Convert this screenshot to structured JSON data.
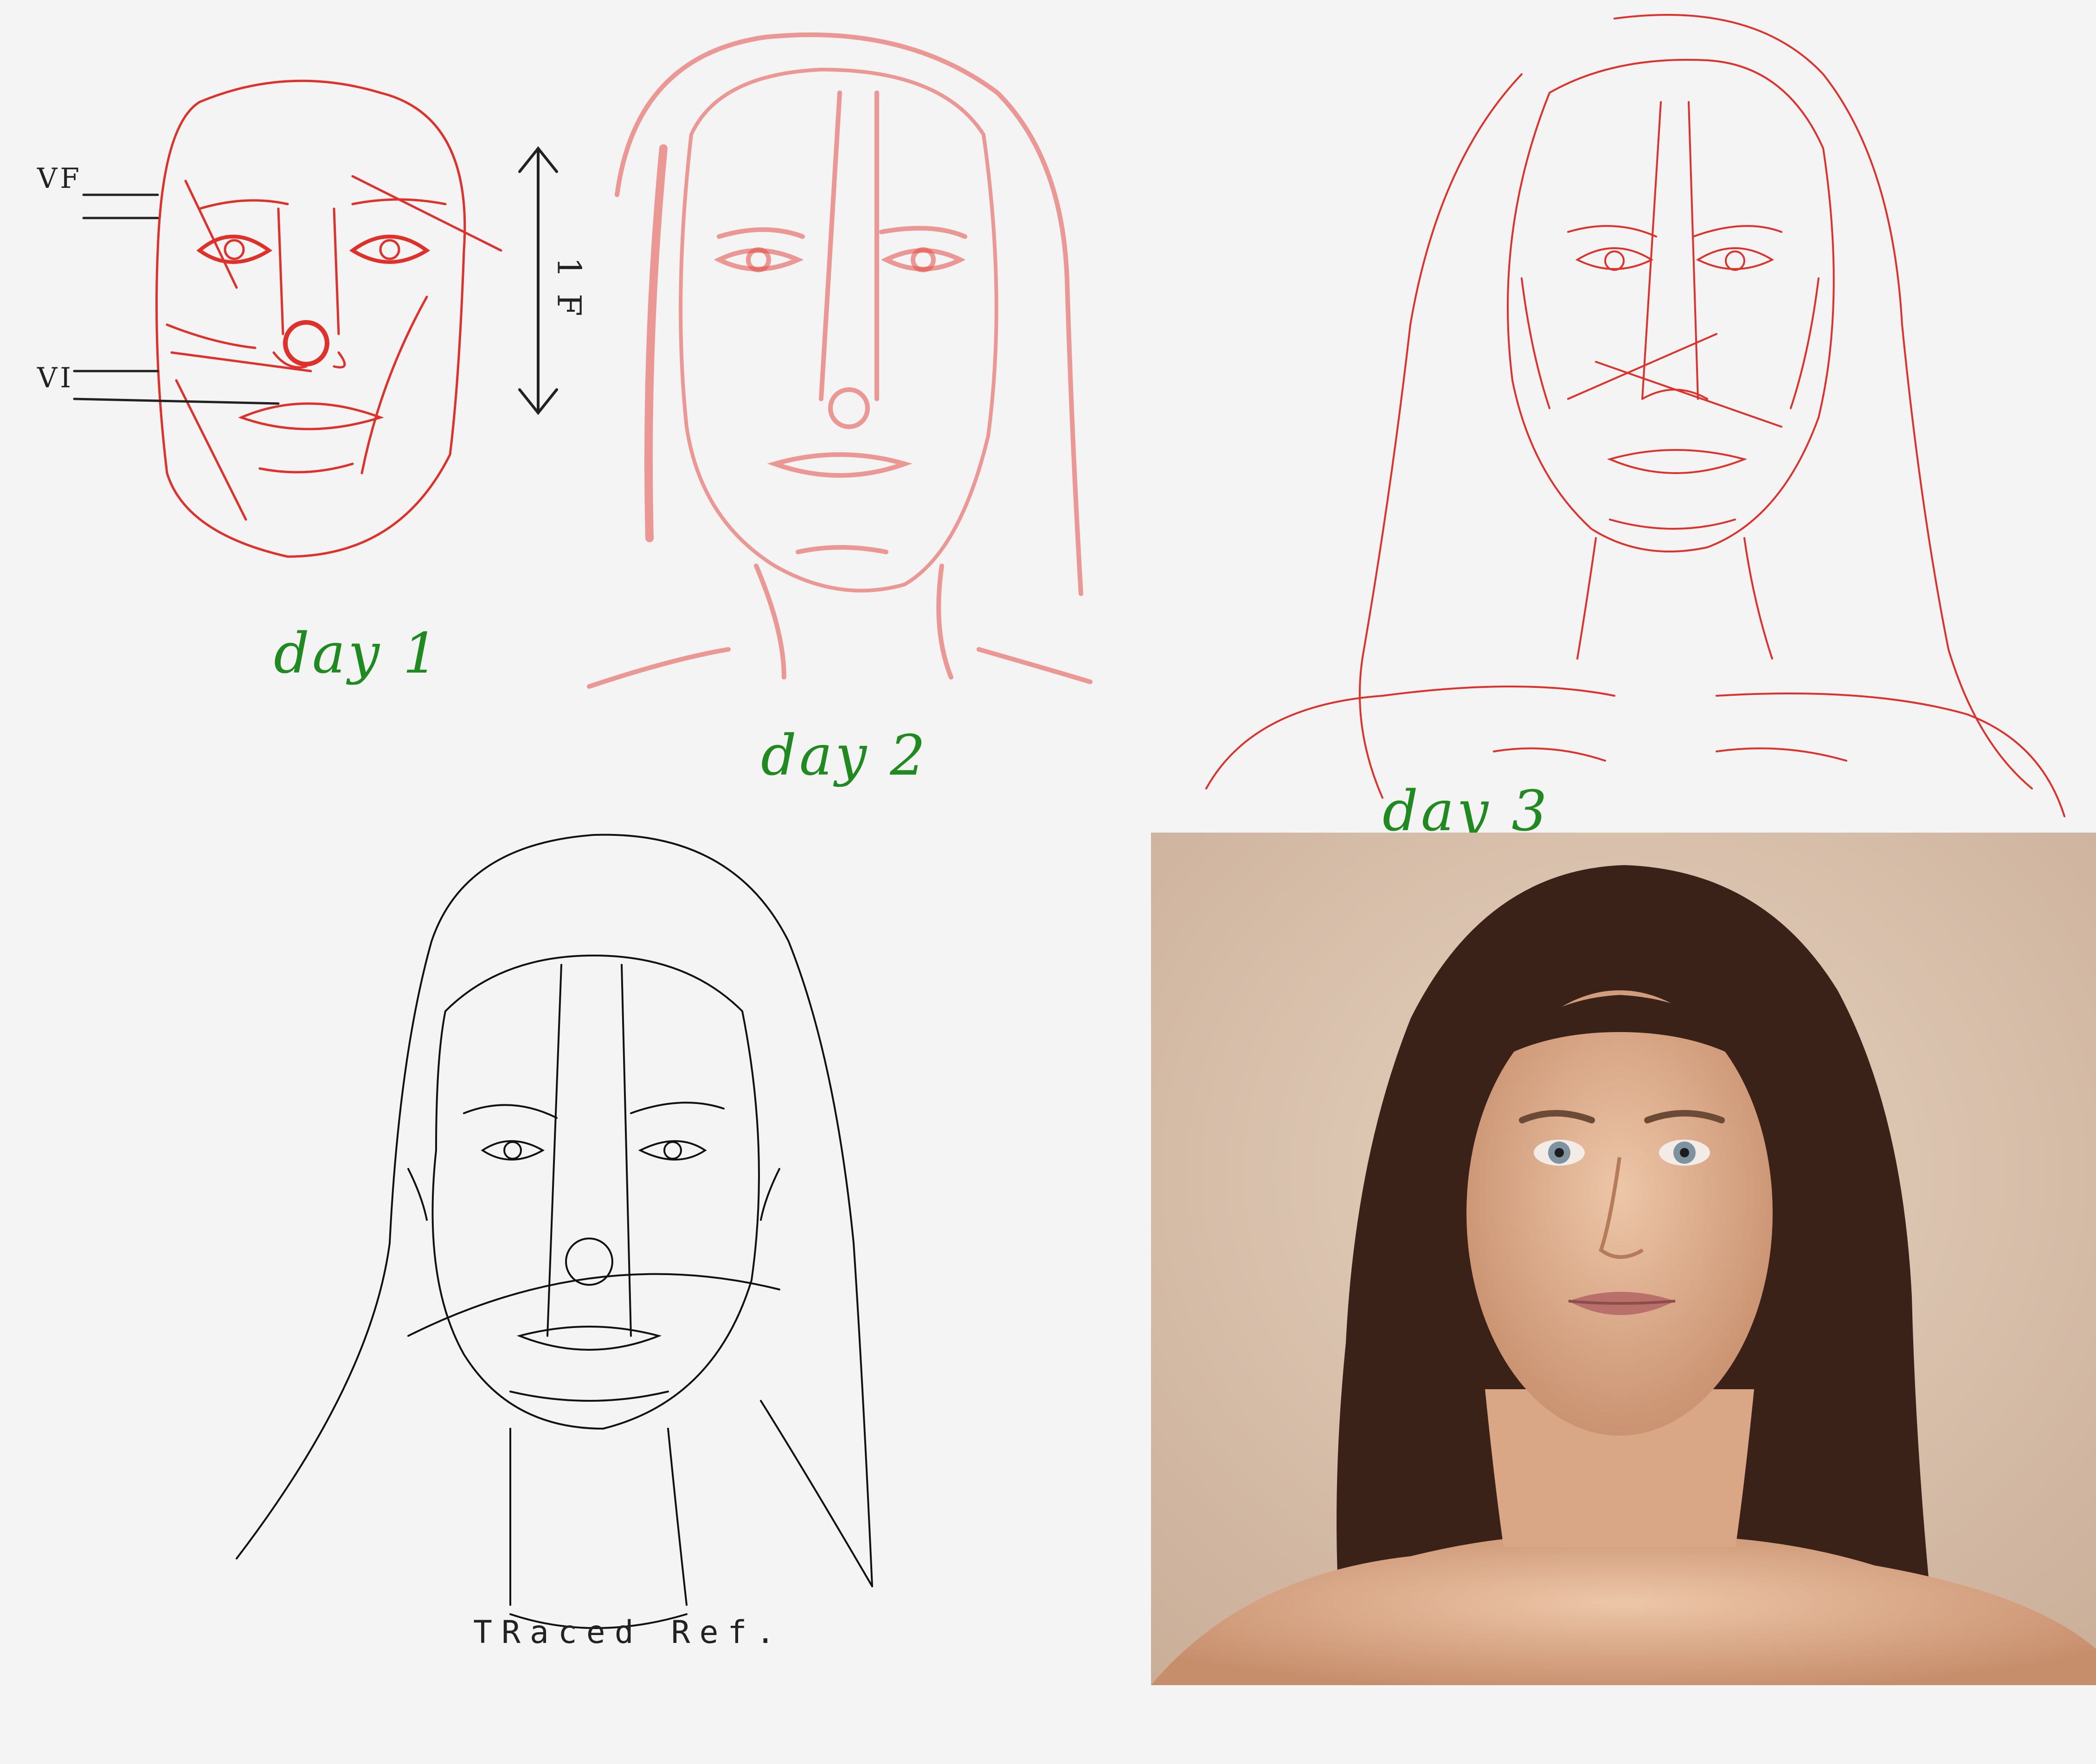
{
  "labels": {
    "day1": "day 1",
    "day2": "day 2",
    "day3": "day 3",
    "traced": "TRaced Ref."
  },
  "annotations": {
    "measure_day1": "1 F",
    "tick_a": "VF",
    "tick_b": "VI"
  },
  "colors": {
    "background": "#f4f4f4",
    "sketch_red": "#e0302a",
    "label_green": "#1f8a1f",
    "trace_black": "#111111",
    "photo_bg": "#dcc5b0",
    "hair": "#3a2218",
    "skin": "#e6b99a"
  }
}
